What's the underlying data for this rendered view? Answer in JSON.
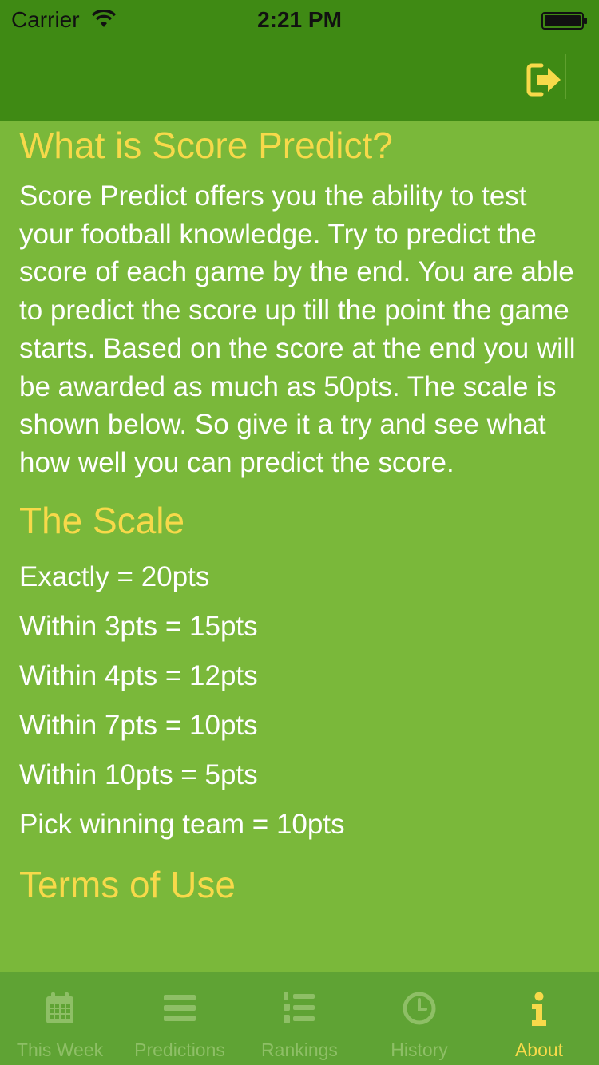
{
  "status_bar": {
    "carrier": "Carrier",
    "time": "2:21 PM"
  },
  "nav_bar": {
    "action_icon": "logout-icon",
    "accent_color": "#f7d94a"
  },
  "content": {
    "what_heading": "What is Score Predict?",
    "what_body": "Score Predict offers you the ability to test your football knowledge. Try to predict the score of each game by the end. You are able to predict the score up till the point the game starts. Based on the score at the end you will be awarded as much as 50pts. The scale is shown below. So give it a try and see what how well you can predict the score.",
    "scale_heading": "The Scale",
    "scale_items": [
      "Exactly = 20pts",
      "Within 3pts = 15pts",
      "Within 4pts = 12pts",
      "Within 7pts = 10pts",
      "Within 10pts = 5pts",
      "Pick winning team = 10pts"
    ],
    "terms_heading": "Terms of Use"
  },
  "tabs": [
    {
      "label": "This Week",
      "icon": "calendar-icon",
      "active": false
    },
    {
      "label": "Predictions",
      "icon": "list-icon",
      "active": false
    },
    {
      "label": "Rankings",
      "icon": "numbered-list-icon",
      "active": false
    },
    {
      "label": "History",
      "icon": "clock-icon",
      "active": false
    },
    {
      "label": "About",
      "icon": "info-icon",
      "active": true
    }
  ],
  "colors": {
    "background": "#7ab83a",
    "bar": "#3f8a14",
    "heading": "#f7d94a",
    "tab_inactive": "#8ebf66"
  }
}
